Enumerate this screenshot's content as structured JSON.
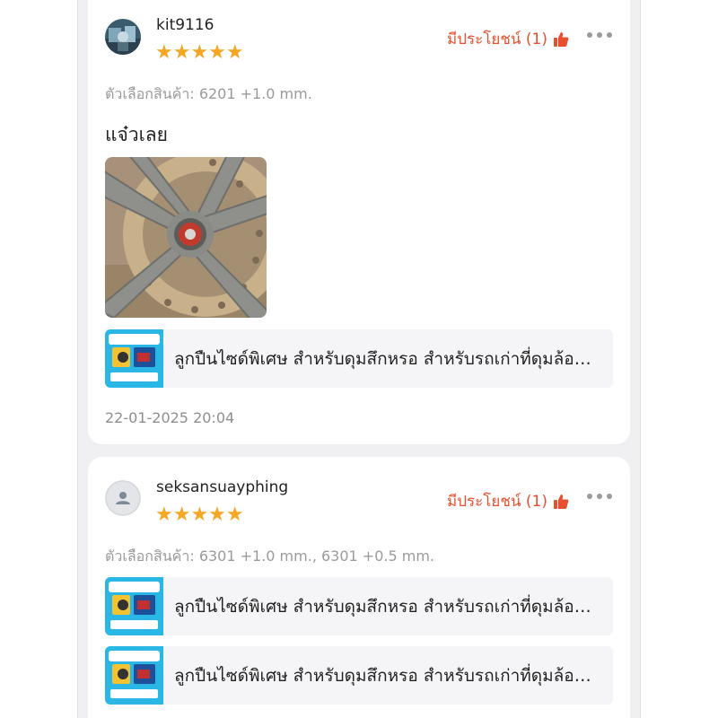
{
  "reviews": [
    {
      "username": "kit9116",
      "stars": "★★★★★",
      "rating": 5,
      "helpful_label": "มีประโยชน์ (1)",
      "variation": "ตัวเลือกสินค้า: 6201 +1.0 mm.",
      "comment": "แจ๋วเลย",
      "products": [
        {
          "name": "ลูกปืนไซด์พิเศษ สำหรับดุมสึกหรอ  สำหรับรถเก่าที่ดุมล้อสึกหรอ"
        }
      ],
      "date": "22-01-2025 20:04"
    },
    {
      "username": "seksansuayphing",
      "stars": "★★★★★",
      "rating": 5,
      "helpful_label": "มีประโยชน์ (1)",
      "variation": "ตัวเลือกสินค้า: 6301 +1.0 mm., 6301 +0.5 mm.",
      "products": [
        {
          "name": "ลูกปืนไซด์พิเศษ สำหรับดุมสึกหรอ  สำหรับรถเก่าที่ดุมล้อสึกหรอ"
        },
        {
          "name": "ลูกปืนไซด์พิเศษ สำหรับดุมสึกหรอ  สำหรับรถเก่าที่ดุมล้อสึกหรอ"
        }
      ]
    }
  ],
  "colors": {
    "accent": "#e8502d",
    "star": "#f5a623",
    "muted": "#9a9a9a",
    "background": "#f0f0f2"
  },
  "icons": {
    "helpful": "thumbs-up-icon",
    "more": "more-dots-icon",
    "default_avatar": "person-icon"
  }
}
